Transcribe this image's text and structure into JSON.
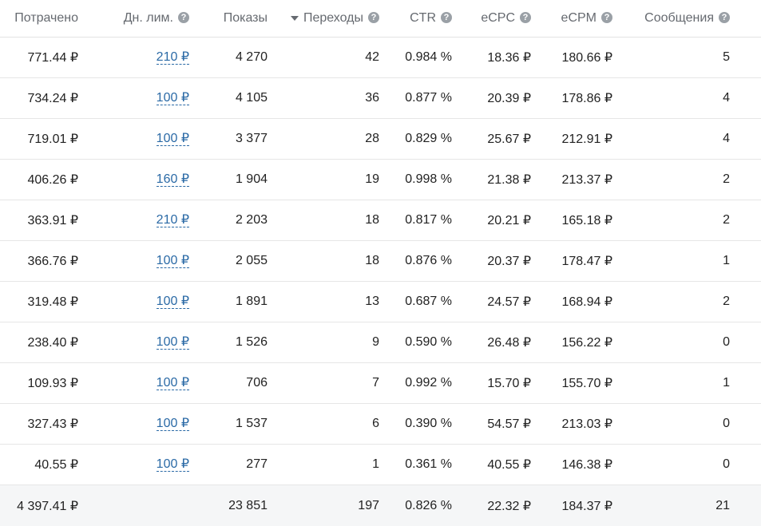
{
  "header": {
    "spent": "Потрачено",
    "daily_limit": "Дн. лим.",
    "impressions": "Показы",
    "clicks": "Переходы",
    "ctr": "CTR",
    "ecpc": "eCPC",
    "ecpm": "eCPM",
    "messages": "Сообщения",
    "help_glyph": "?"
  },
  "rows": [
    {
      "spent": "771.44 ₽",
      "limit": "210 ₽",
      "impressions": "4 270",
      "clicks": "42",
      "ctr": "0.984 %",
      "ecpc": "18.36 ₽",
      "ecpm": "180.66 ₽",
      "messages": "5"
    },
    {
      "spent": "734.24 ₽",
      "limit": "100 ₽",
      "impressions": "4 105",
      "clicks": "36",
      "ctr": "0.877 %",
      "ecpc": "20.39 ₽",
      "ecpm": "178.86 ₽",
      "messages": "4"
    },
    {
      "spent": "719.01 ₽",
      "limit": "100 ₽",
      "impressions": "3 377",
      "clicks": "28",
      "ctr": "0.829 %",
      "ecpc": "25.67 ₽",
      "ecpm": "212.91 ₽",
      "messages": "4"
    },
    {
      "spent": "406.26 ₽",
      "limit": "160 ₽",
      "impressions": "1 904",
      "clicks": "19",
      "ctr": "0.998 %",
      "ecpc": "21.38 ₽",
      "ecpm": "213.37 ₽",
      "messages": "2"
    },
    {
      "spent": "363.91 ₽",
      "limit": "210 ₽",
      "impressions": "2 203",
      "clicks": "18",
      "ctr": "0.817 %",
      "ecpc": "20.21 ₽",
      "ecpm": "165.18 ₽",
      "messages": "2"
    },
    {
      "spent": "366.76 ₽",
      "limit": "100 ₽",
      "impressions": "2 055",
      "clicks": "18",
      "ctr": "0.876 %",
      "ecpc": "20.37 ₽",
      "ecpm": "178.47 ₽",
      "messages": "1"
    },
    {
      "spent": "319.48 ₽",
      "limit": "100 ₽",
      "impressions": "1 891",
      "clicks": "13",
      "ctr": "0.687 %",
      "ecpc": "24.57 ₽",
      "ecpm": "168.94 ₽",
      "messages": "2"
    },
    {
      "spent": "238.40 ₽",
      "limit": "100 ₽",
      "impressions": "1 526",
      "clicks": "9",
      "ctr": "0.590 %",
      "ecpc": "26.48 ₽",
      "ecpm": "156.22 ₽",
      "messages": "0"
    },
    {
      "spent": "109.93 ₽",
      "limit": "100 ₽",
      "impressions": "706",
      "clicks": "7",
      "ctr": "0.992 %",
      "ecpc": "15.70 ₽",
      "ecpm": "155.70 ₽",
      "messages": "1"
    },
    {
      "spent": "327.43 ₽",
      "limit": "100 ₽",
      "impressions": "1 537",
      "clicks": "6",
      "ctr": "0.390 %",
      "ecpc": "54.57 ₽",
      "ecpm": "213.03 ₽",
      "messages": "0"
    },
    {
      "spent": "40.55 ₽",
      "limit": "100 ₽",
      "impressions": "277",
      "clicks": "1",
      "ctr": "0.361 %",
      "ecpc": "40.55 ₽",
      "ecpm": "146.38 ₽",
      "messages": "0"
    }
  ],
  "totals": {
    "spent": "4 397.41 ₽",
    "impressions": "23 851",
    "clicks": "197",
    "ctr": "0.826 %",
    "ecpc": "22.32 ₽",
    "ecpm": "184.37 ₽",
    "messages": "21"
  },
  "icons": {
    "help": "question-circle-icon",
    "sort": "sort-desc-icon"
  },
  "colors": {
    "link": "#2b6aa6",
    "header_text": "#666a70",
    "help_icon_bg": "#9aa0a6",
    "total_row_bg": "#f5f6f7"
  }
}
